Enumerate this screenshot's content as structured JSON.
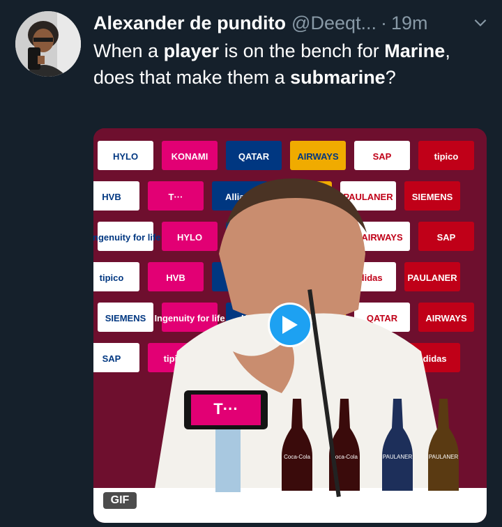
{
  "tweet": {
    "display_name": "Alexander de pundito",
    "handle": "@Deeqt...",
    "separator": "·",
    "timestamp": "19m",
    "text": {
      "p1": "When a ",
      "b1": "player",
      "p2": " is on the bench for ",
      "b2": "Marine",
      "p3": ", does that make them a ",
      "b3": "submarine",
      "p4": "?"
    }
  },
  "media": {
    "type": "gif",
    "badge": "GIF",
    "play_icon": "play-icon",
    "sponsor_logos": [
      "HYLO",
      "KONAMI",
      "QATAR",
      "AIRWAYS",
      "SAP",
      "tipico",
      "HVB",
      "T···",
      "Allianz",
      "adidas",
      "PAULANER",
      "SIEMENS",
      "Ingenuity for life"
    ],
    "bottle_labels": [
      "Coca-Cola",
      "Coca-Cola",
      "PAULANER",
      "PAULANER"
    ],
    "phone_logo": "T···"
  },
  "colors": {
    "background": "#15202b",
    "text_primary": "#ffffff",
    "text_secondary": "#8899a6",
    "accent": "#1da1f2"
  }
}
